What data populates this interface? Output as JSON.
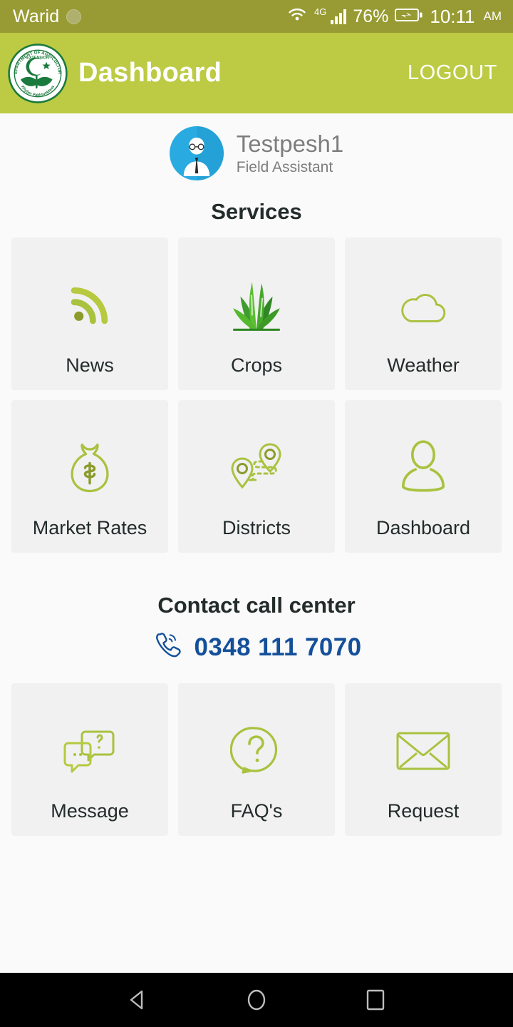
{
  "status_bar": {
    "carrier": "Warid",
    "sim_icon": "sim-dot-icon",
    "wifi_icon": "wifi-icon",
    "network_type": "4G",
    "signal_icon": "signal-bars-icon",
    "battery_percent": "76%",
    "battery_icon": "battery-charging-icon",
    "time": "10:11",
    "meridiem": "AM",
    "background_color": "#989B33"
  },
  "app_bar": {
    "logo_icon": "agriculture-department-logo-icon",
    "logo_text_top": "DEPARTMENT OF AGRICULTURE",
    "logo_text_mid": "EXTENSION",
    "logo_text_bottom": "Khyber Pakhtunkhwa",
    "title": "Dashboard",
    "logout_label": "LOGOUT",
    "background_color": "#BCCB43"
  },
  "profile": {
    "avatar_icon": "user-avatar-icon",
    "name": "Testpesh1",
    "role": "Field Assistant"
  },
  "services": {
    "heading": "Services",
    "tiles": [
      {
        "label": "News",
        "icon": "rss-feed-icon"
      },
      {
        "label": "Crops",
        "icon": "grass-crop-icon"
      },
      {
        "label": "Weather",
        "icon": "cloud-icon"
      },
      {
        "label": "Market Rates",
        "icon": "money-bag-icon"
      },
      {
        "label": "Districts",
        "icon": "map-route-pins-icon"
      },
      {
        "label": "Dashboard",
        "icon": "person-icon"
      }
    ]
  },
  "contact": {
    "heading": "Contact call center",
    "phone_icon": "phone-ringing-icon",
    "phone_number": "0348 111 7070",
    "phone_color": "#14509A",
    "tiles": [
      {
        "label": "Message",
        "icon": "chat-bubbles-icon"
      },
      {
        "label": "FAQ's",
        "icon": "question-bubble-icon"
      },
      {
        "label": "Request",
        "icon": "envelope-icon"
      }
    ]
  },
  "nav_bar": {
    "back_icon": "back-triangle-icon",
    "home_icon": "home-circle-icon",
    "recents_icon": "recents-square-icon"
  },
  "theme": {
    "accent_green": "#BCCB43",
    "status_olive": "#989B33",
    "tile_bg": "#F1F1F1",
    "page_bg": "#FAFAFA"
  }
}
